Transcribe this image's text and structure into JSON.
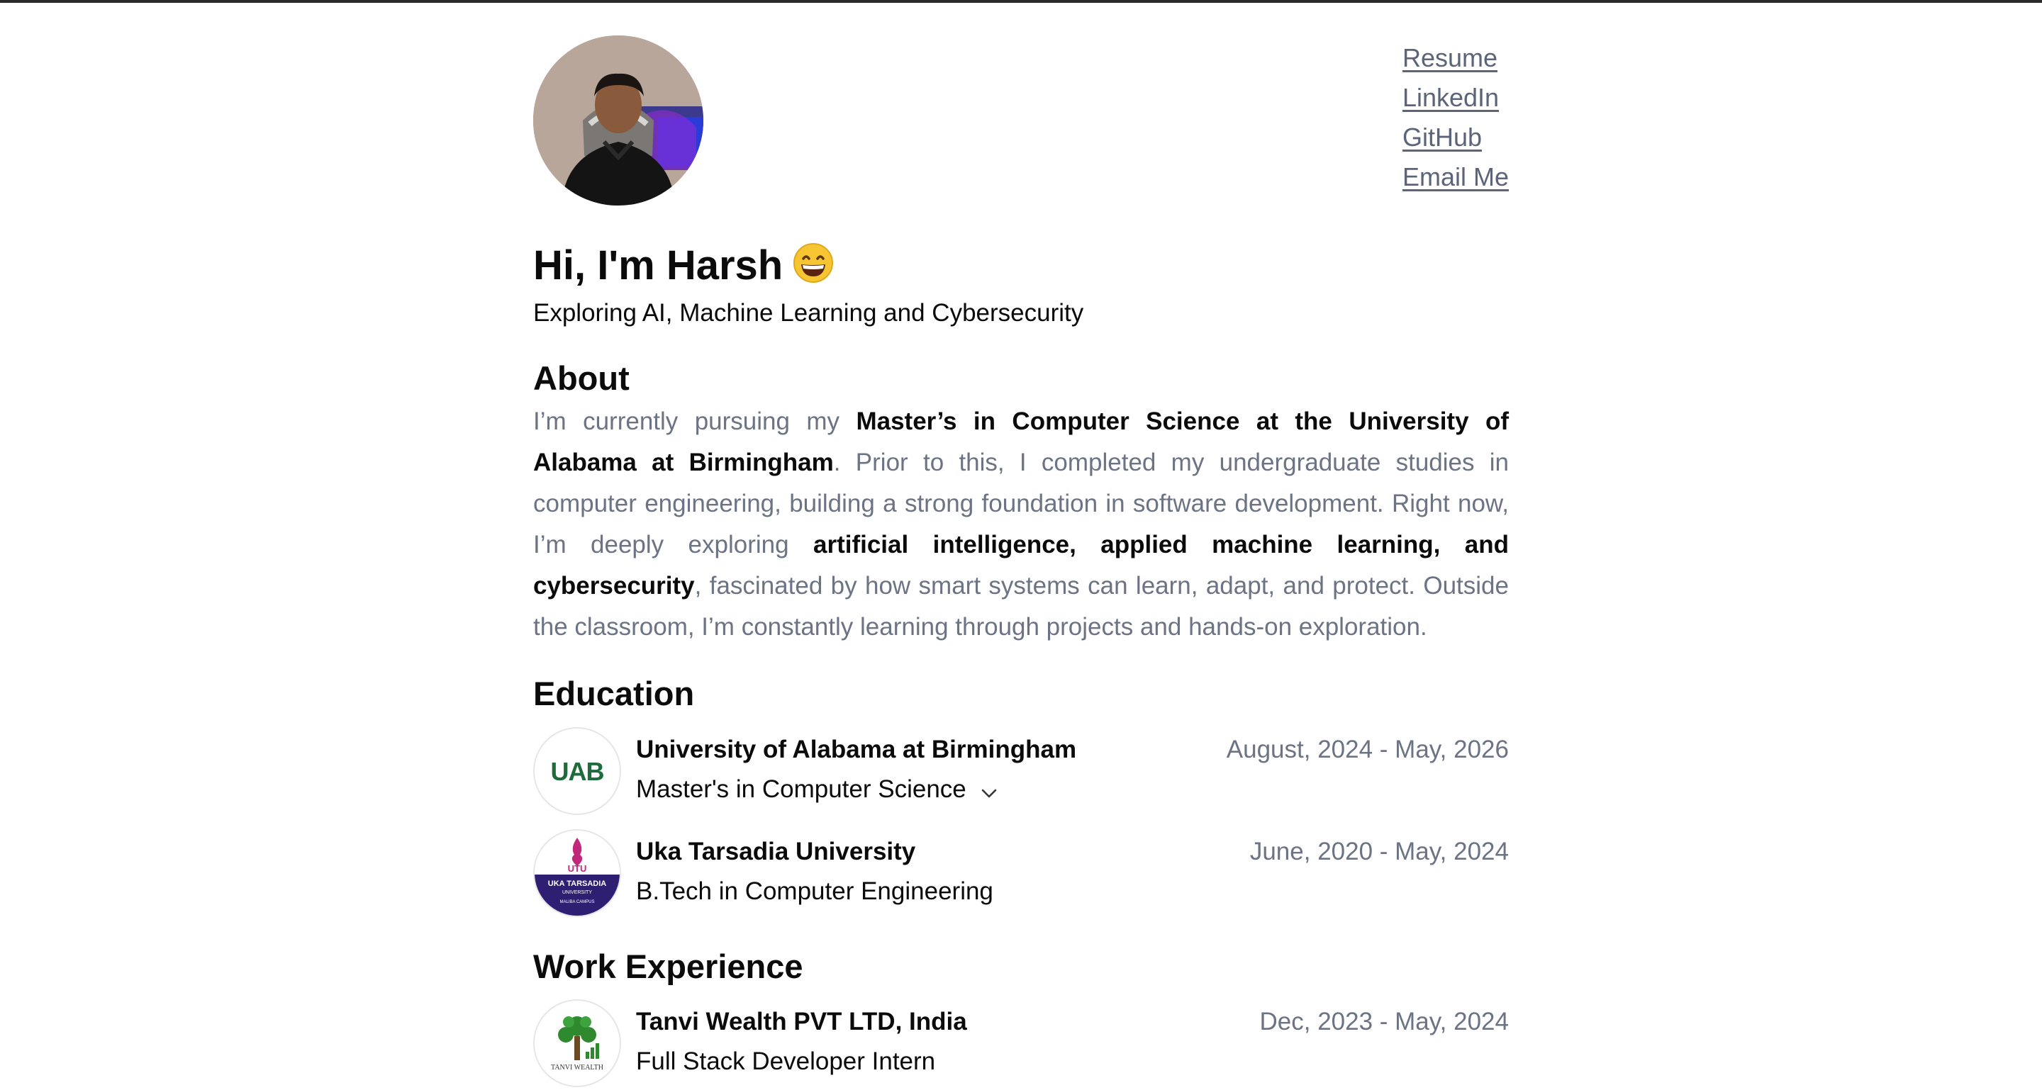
{
  "nav": {
    "links": [
      "Resume",
      "LinkedIn",
      "GitHub",
      "Email Me"
    ]
  },
  "hero": {
    "greeting": "Hi, I'm Harsh",
    "emoji": "grinning-face-emoji",
    "subtitle": "Exploring AI, Machine Learning and Cybersecurity"
  },
  "about": {
    "heading": "About",
    "parts": [
      "I’m currently pursuing my ",
      "Master’s in Computer Science at the University of Alabama at Birmingham",
      ". Prior to this, I completed my undergraduate studies in computer engineering, building a strong foundation in software development. Right now, I’m deeply exploring ",
      "artificial intelligence, applied machine learning, and cybersecurity",
      ", fascinated by how smart systems can learn, adapt, and protect. Outside the classroom, I’m constantly learning through projects and hands-on exploration."
    ]
  },
  "education": {
    "heading": "Education",
    "items": [
      {
        "org": "University of Alabama at Birmingham",
        "degree": "Master's in Computer Science",
        "dates": "August, 2024 - May, 2026",
        "logo_text": "UAB"
      },
      {
        "org": "Uka Tarsadia University",
        "degree": "B.Tech in Computer Engineering",
        "dates": "June, 2020 - May, 2024",
        "logo_text": [
          "UTU",
          "UKA TARSADIA",
          "UNIVERSITY",
          "MALIBA CAMPUS"
        ]
      }
    ]
  },
  "work": {
    "heading": "Work Experience",
    "items": [
      {
        "org": "Tanvi Wealth PVT LTD, India",
        "role": "Full Stack Developer Intern",
        "dates": "Dec, 2023 - May, 2024",
        "logo_text": "TANVI WEALTH"
      }
    ]
  },
  "colors": {
    "text": "#0b0b0b",
    "muted": "#6b7384",
    "link": "#5b6478",
    "uab_green": "#1e6b3c",
    "utu_purple": "#2e1f73",
    "tanvi_green": "#2f8a2f"
  }
}
